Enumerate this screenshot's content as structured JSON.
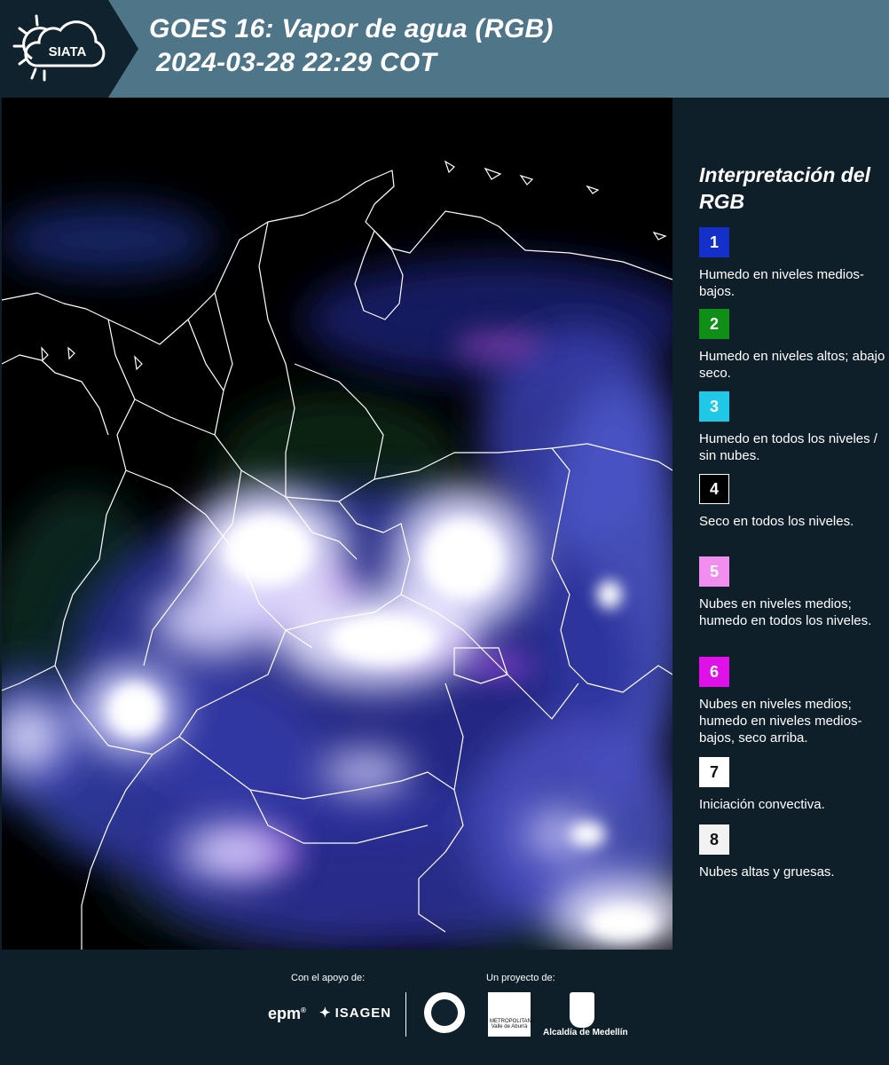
{
  "header": {
    "logo_text": "SIATA",
    "title_line1": "GOES 16: Vapor de agua (RGB)",
    "title_line2": "2024-03-28 22:29 COT"
  },
  "legend": {
    "title": "Interpretación del RGB",
    "items": [
      {
        "number": "1",
        "color": "#1530c8",
        "text": "Humedo en niveles medios-bajos."
      },
      {
        "number": "2",
        "color": "#0f8f18",
        "text": "Humedo en niveles altos; abajo seco."
      },
      {
        "number": "3",
        "color": "#20c8e8",
        "text": "Humedo en todos los niveles / sin nubes."
      },
      {
        "number": "4",
        "color": "#000000",
        "text": "Seco en todos los niveles."
      },
      {
        "number": "5",
        "color": "#f28ef0",
        "text": "Nubes en niveles medios; humedo en todos los niveles."
      },
      {
        "number": "6",
        "color": "#e010e8",
        "text": "Nubes en niveles medios; humedo en niveles medios-bajos, seco arriba."
      },
      {
        "number": "7",
        "color": "#ffffff",
        "text": "Iniciación convectiva."
      },
      {
        "number": "8",
        "color": "#f2f2f2",
        "text": "Nubes altas y gruesas."
      }
    ]
  },
  "footer": {
    "support_label": "Con el apoyo de:",
    "project_label": "Un proyecto de:",
    "epm": "epm",
    "isagen": "ISAGEN",
    "area_text": "METROPOLITANA Valle de Aburrá",
    "alcaldia": "Alcaldía de Medellín"
  }
}
